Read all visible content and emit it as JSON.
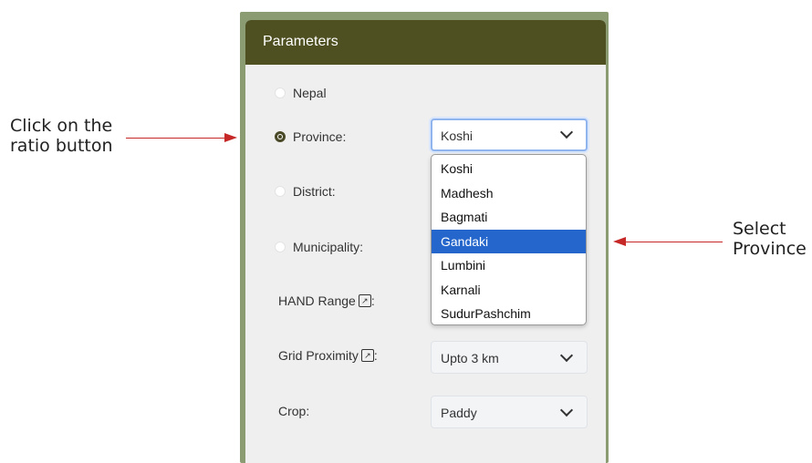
{
  "panel": {
    "title": "Parameters",
    "options": [
      {
        "label": "Nepal",
        "checked": false
      },
      {
        "label": "Province:",
        "checked": true,
        "select_value": "Koshi"
      },
      {
        "label": "District:",
        "checked": false
      },
      {
        "label": "Municipality:",
        "checked": false
      }
    ],
    "hand_range": {
      "label": "HAND Range",
      "icon": "external-link-icon",
      "suffix": ":"
    },
    "grid_proximity": {
      "label": "Grid Proximity",
      "icon": "external-link-icon",
      "suffix": ":",
      "value": "Upto 3 km"
    },
    "crop": {
      "label": "Crop:",
      "value": "Paddy"
    },
    "province_dropdown": {
      "items": [
        "Koshi",
        "Madhesh",
        "Bagmati",
        "Gandaki",
        "Lumbini",
        "Karnali",
        "SudurPashchim"
      ],
      "highlighted": "Gandaki"
    }
  },
  "annotations": {
    "left": {
      "line1": "Click on the",
      "line2": "ratio button"
    },
    "right": {
      "line1": "Select",
      "line2": "Province"
    }
  },
  "colors": {
    "header_bg": "#4e5021",
    "frame": "#8c9c72",
    "highlight": "#2566cc",
    "arrow": "#c62828"
  }
}
